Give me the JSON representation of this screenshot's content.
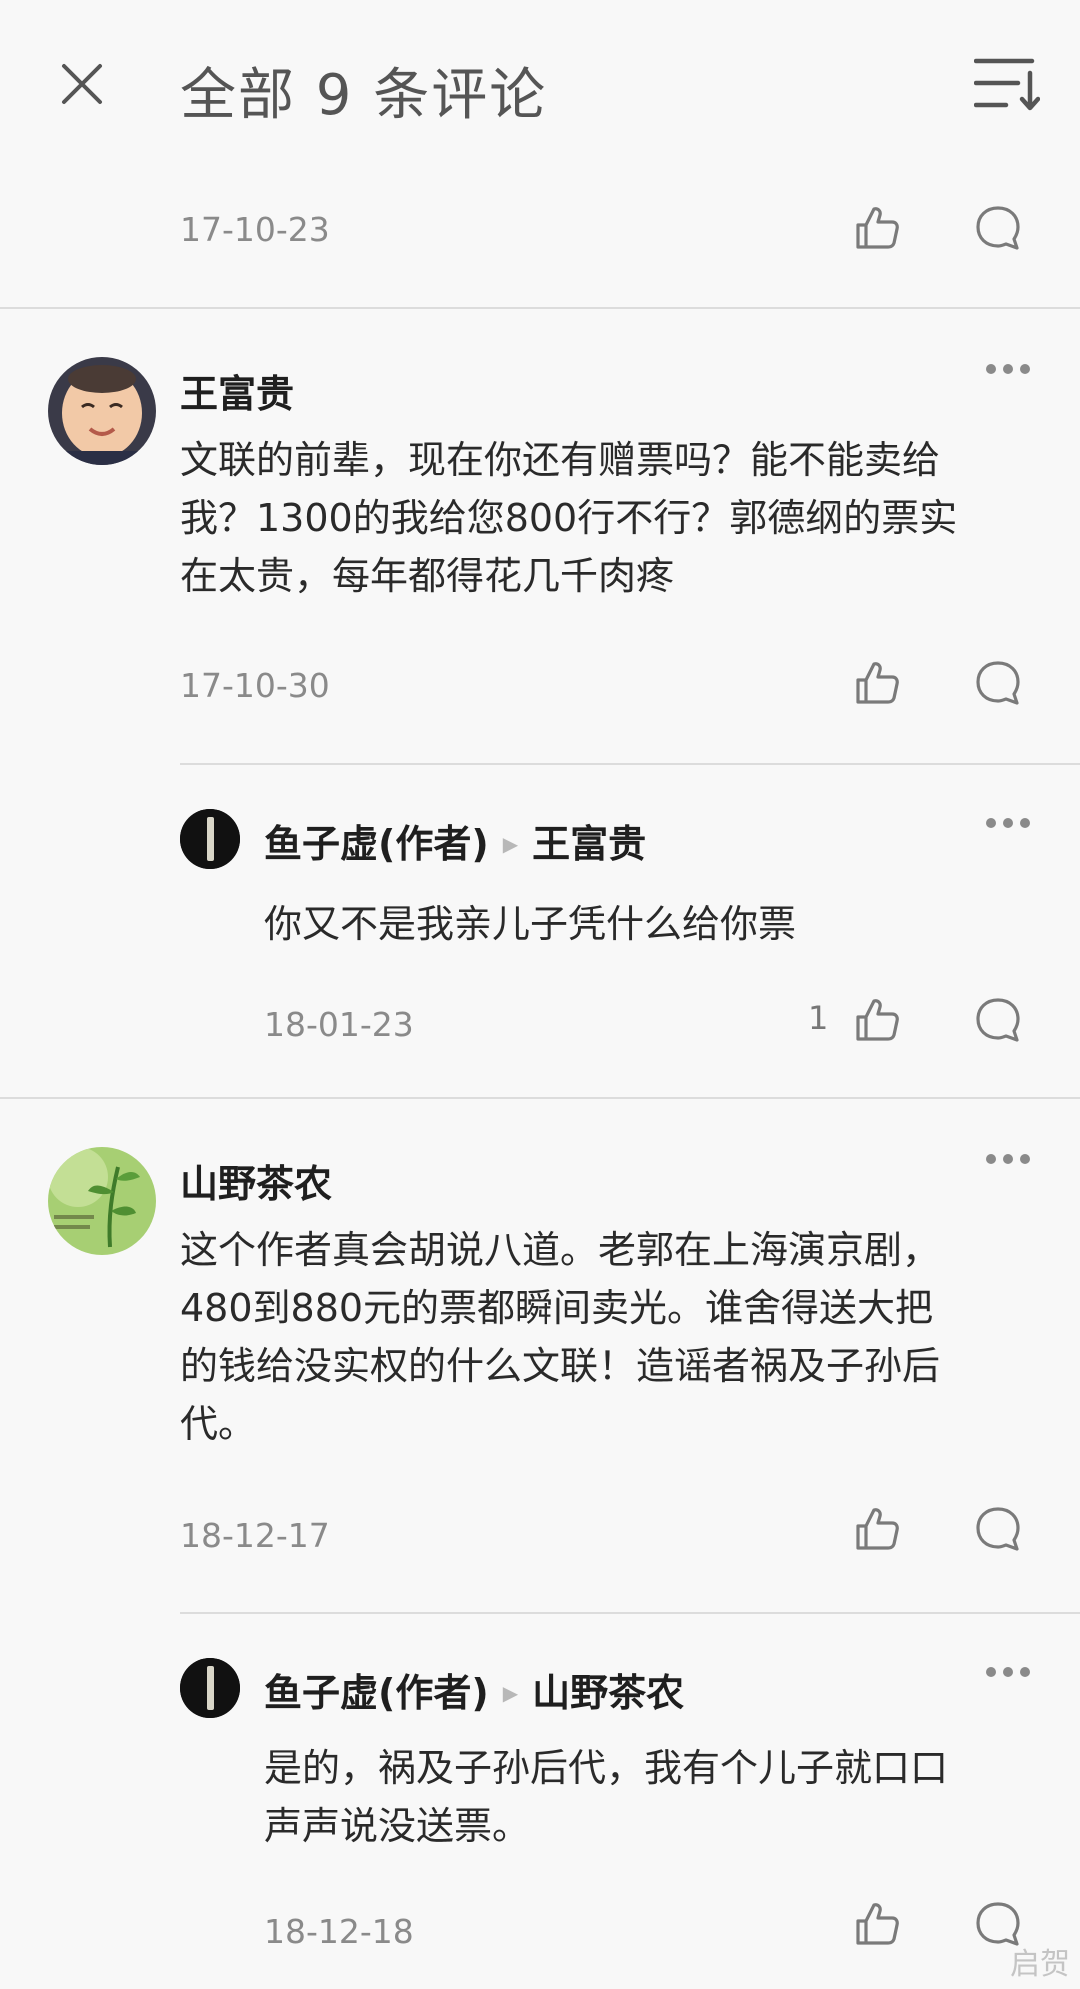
{
  "header": {
    "title": "全部 9 条评论"
  },
  "comments": [
    {
      "date": "17-10-23"
    },
    {
      "user": "王富贵",
      "text_lines": [
        "文联的前辈，现在你还有赠票吗？能不能卖给",
        "我？1300的我给您800行不行？郭德纲的票实",
        "在太贵，每年都得花几千肉疼"
      ],
      "date": "17-10-30"
    },
    {
      "user": "鱼子虚(作者)",
      "reply_to": "王富贵",
      "text_lines": [
        "你又不是我亲儿子凭什么给你票"
      ],
      "date": "18-01-23",
      "likes": "1"
    },
    {
      "user": "山野茶农",
      "text_lines": [
        "这个作者真会胡说八道。老郭在上海演京剧，",
        "480到880元的票都瞬间卖光。谁舍得送大把",
        "的钱给没实权的什么文联！造谣者祸及子孙后",
        "代。"
      ],
      "date": "18-12-17"
    },
    {
      "user": "鱼子虚(作者)",
      "reply_to": "山野茶农",
      "text_lines": [
        "是的，祸及子孙后代，我有个儿子就口口",
        "声声说没送票。"
      ],
      "date": "18-12-18"
    }
  ],
  "watermark": "启贺",
  "icons": {
    "close": "close-icon",
    "sort": "sort-icon",
    "like": "thumbs-up-icon",
    "reply": "speech-bubble-icon",
    "more": "more-dots-icon"
  },
  "colors": {
    "background": "#f8f8f8",
    "text": "#1f1f1f",
    "muted": "#8a8a8a",
    "divider": "#dcdcdc"
  }
}
